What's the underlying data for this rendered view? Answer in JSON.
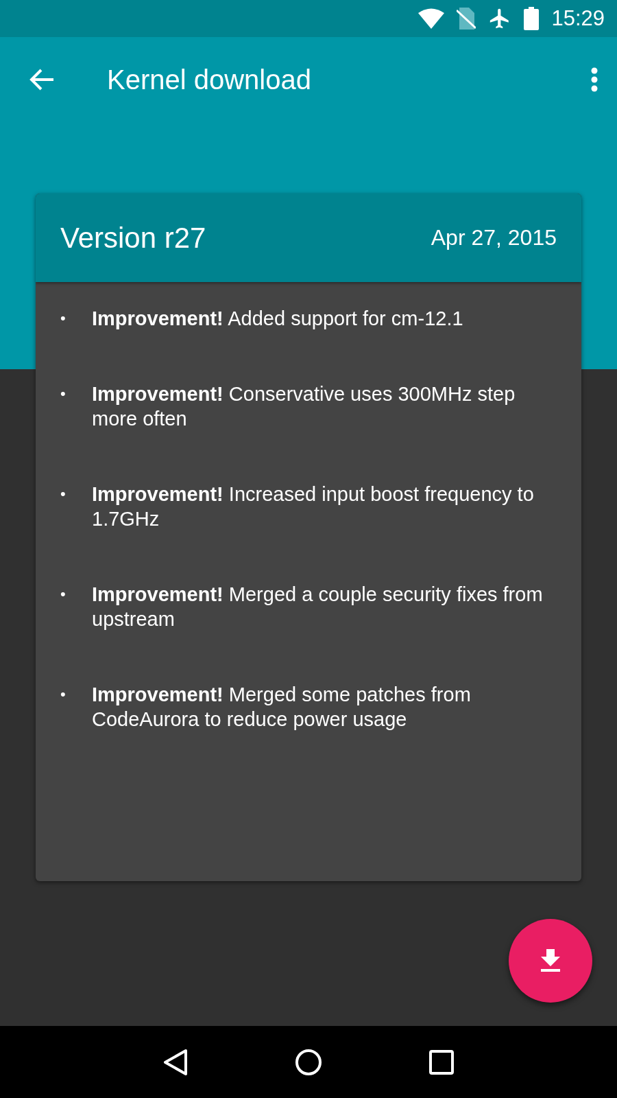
{
  "status_bar": {
    "time": "15:29"
  },
  "toolbar": {
    "title": "Kernel download"
  },
  "card": {
    "title": "Version r27",
    "date": "Apr 27, 2015",
    "items": [
      {
        "bullet": "•",
        "text": "**Improvement!** Added support for cm-12.1"
      },
      {
        "bullet": "•",
        "text": "**Improvement!** Conservative uses 300MHz step more often"
      },
      {
        "bullet": "•",
        "text": "**Improvement!** Increased input boost frequency to 1.7GHz"
      },
      {
        "bullet": "•",
        "text": "**Improvement!** Merged a couple security fixes from upstream"
      },
      {
        "bullet": "•",
        "text": "**Improvement!** Merged some patches from CodeAurora to reduce power usage"
      }
    ]
  }
}
